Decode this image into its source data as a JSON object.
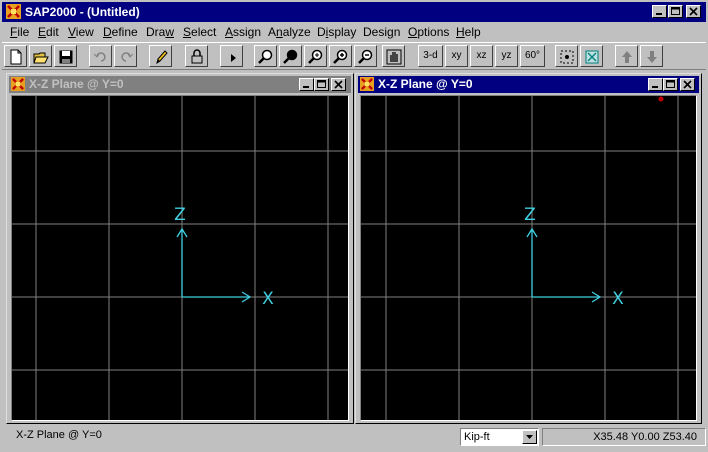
{
  "app": {
    "title": "SAP2000 - (Untitled)"
  },
  "menu": [
    {
      "accel": "F",
      "rest": "ile"
    },
    {
      "accel": "E",
      "rest": "dit"
    },
    {
      "accel": "V",
      "rest": "iew"
    },
    {
      "accel": "D",
      "rest": "efine"
    },
    {
      "pre": "Dra",
      "accel": "w",
      "rest": ""
    },
    {
      "accel": "S",
      "rest": "elect"
    },
    {
      "accel": "A",
      "rest": "ssign"
    },
    {
      "pre": "A",
      "accel": "n",
      "rest": "alyze"
    },
    {
      "pre": "D",
      "accel": "i",
      "rest": "splay"
    },
    {
      "pre": "Desi",
      "accel": "g",
      "rest": "n"
    },
    {
      "accel": "O",
      "rest": "ptions"
    },
    {
      "accel": "H",
      "rest": "elp"
    }
  ],
  "toolbar": {
    "view_3d": "3-d",
    "view_xy": "xy",
    "view_xz": "xz",
    "view_yz": "yz",
    "perspective": "60°"
  },
  "windows": {
    "left": {
      "title": "X-Z Plane @ Y=0",
      "active": false
    },
    "right": {
      "title": "X-Z Plane @ Y=0",
      "active": true
    }
  },
  "axes": {
    "vertical_label": "Z",
    "horizontal_label": "X"
  },
  "status": {
    "view_text": "X-Z Plane @ Y=0",
    "units": "Kip-ft",
    "coordinates": "X35.48  Y0.00  Z53.40"
  },
  "colors": {
    "titlebar_active": "#000080",
    "titlebar_inactive": "#808080",
    "canvas_bg": "#000000",
    "grid_line": "#808080",
    "axis_cyan": "#40d0e0",
    "marker_red": "#c00000"
  }
}
